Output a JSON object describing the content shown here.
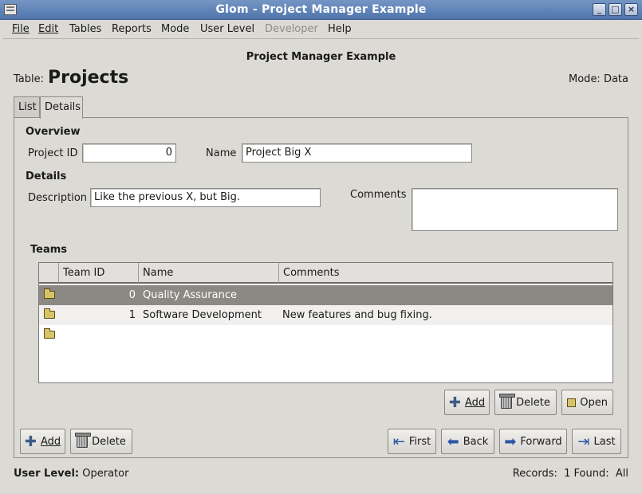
{
  "window": {
    "title": "Glom - Project Manager Example"
  },
  "menu": [
    {
      "id": "file",
      "label": "File",
      "disabled": false
    },
    {
      "id": "edit",
      "label": "Edit",
      "disabled": false
    },
    {
      "id": "tables",
      "label": "Tables",
      "disabled": false
    },
    {
      "id": "reports",
      "label": "Reports",
      "disabled": false
    },
    {
      "id": "mode",
      "label": "Mode",
      "disabled": false
    },
    {
      "id": "user-level",
      "label": "User Level",
      "disabled": false
    },
    {
      "id": "developer",
      "label": "Developer",
      "disabled": true
    },
    {
      "id": "help",
      "label": "Help",
      "disabled": false
    }
  ],
  "header": {
    "document_title": "Project Manager Example",
    "table_label": "Table:",
    "table_name": "Projects",
    "mode_text": "Mode: Data"
  },
  "tabs": [
    {
      "label": "List",
      "active": false
    },
    {
      "label": "Details",
      "active": true
    }
  ],
  "overview": {
    "heading": "Overview",
    "project_id_label": "Project ID",
    "project_id_value": "0",
    "name_label": "Name",
    "name_value": "Project Big X"
  },
  "details": {
    "heading": "Details",
    "description_label": "Description",
    "description_value": "Like the previous X, but Big.",
    "comments_label": "Comments",
    "comments_value": ""
  },
  "teams": {
    "heading": "Teams",
    "columns": [
      "Team ID",
      "Name",
      "Comments"
    ],
    "rows": [
      {
        "team_id": "0",
        "name": "Quality Assurance",
        "comments": "",
        "selected": true
      },
      {
        "team_id": "1",
        "name": "Software Development",
        "comments": "New features and bug fixing.",
        "selected": false
      },
      {
        "team_id": "",
        "name": "",
        "comments": "",
        "selected": false
      }
    ],
    "buttons": {
      "add": "Add",
      "delete": "Delete",
      "open": "Open"
    }
  },
  "record_buttons": {
    "add": "Add",
    "delete": "Delete"
  },
  "nav_buttons": {
    "first": "First",
    "back": "Back",
    "forward": "Forward",
    "last": "Last"
  },
  "status": {
    "user_level_label": "User Level:",
    "user_level_value": "Operator",
    "records_text": "Records:  1 Found:  All"
  },
  "colors": {
    "titlebar": "#4f75ad",
    "selected_row": "#8c8984",
    "window_bg": "#dcdad5"
  }
}
